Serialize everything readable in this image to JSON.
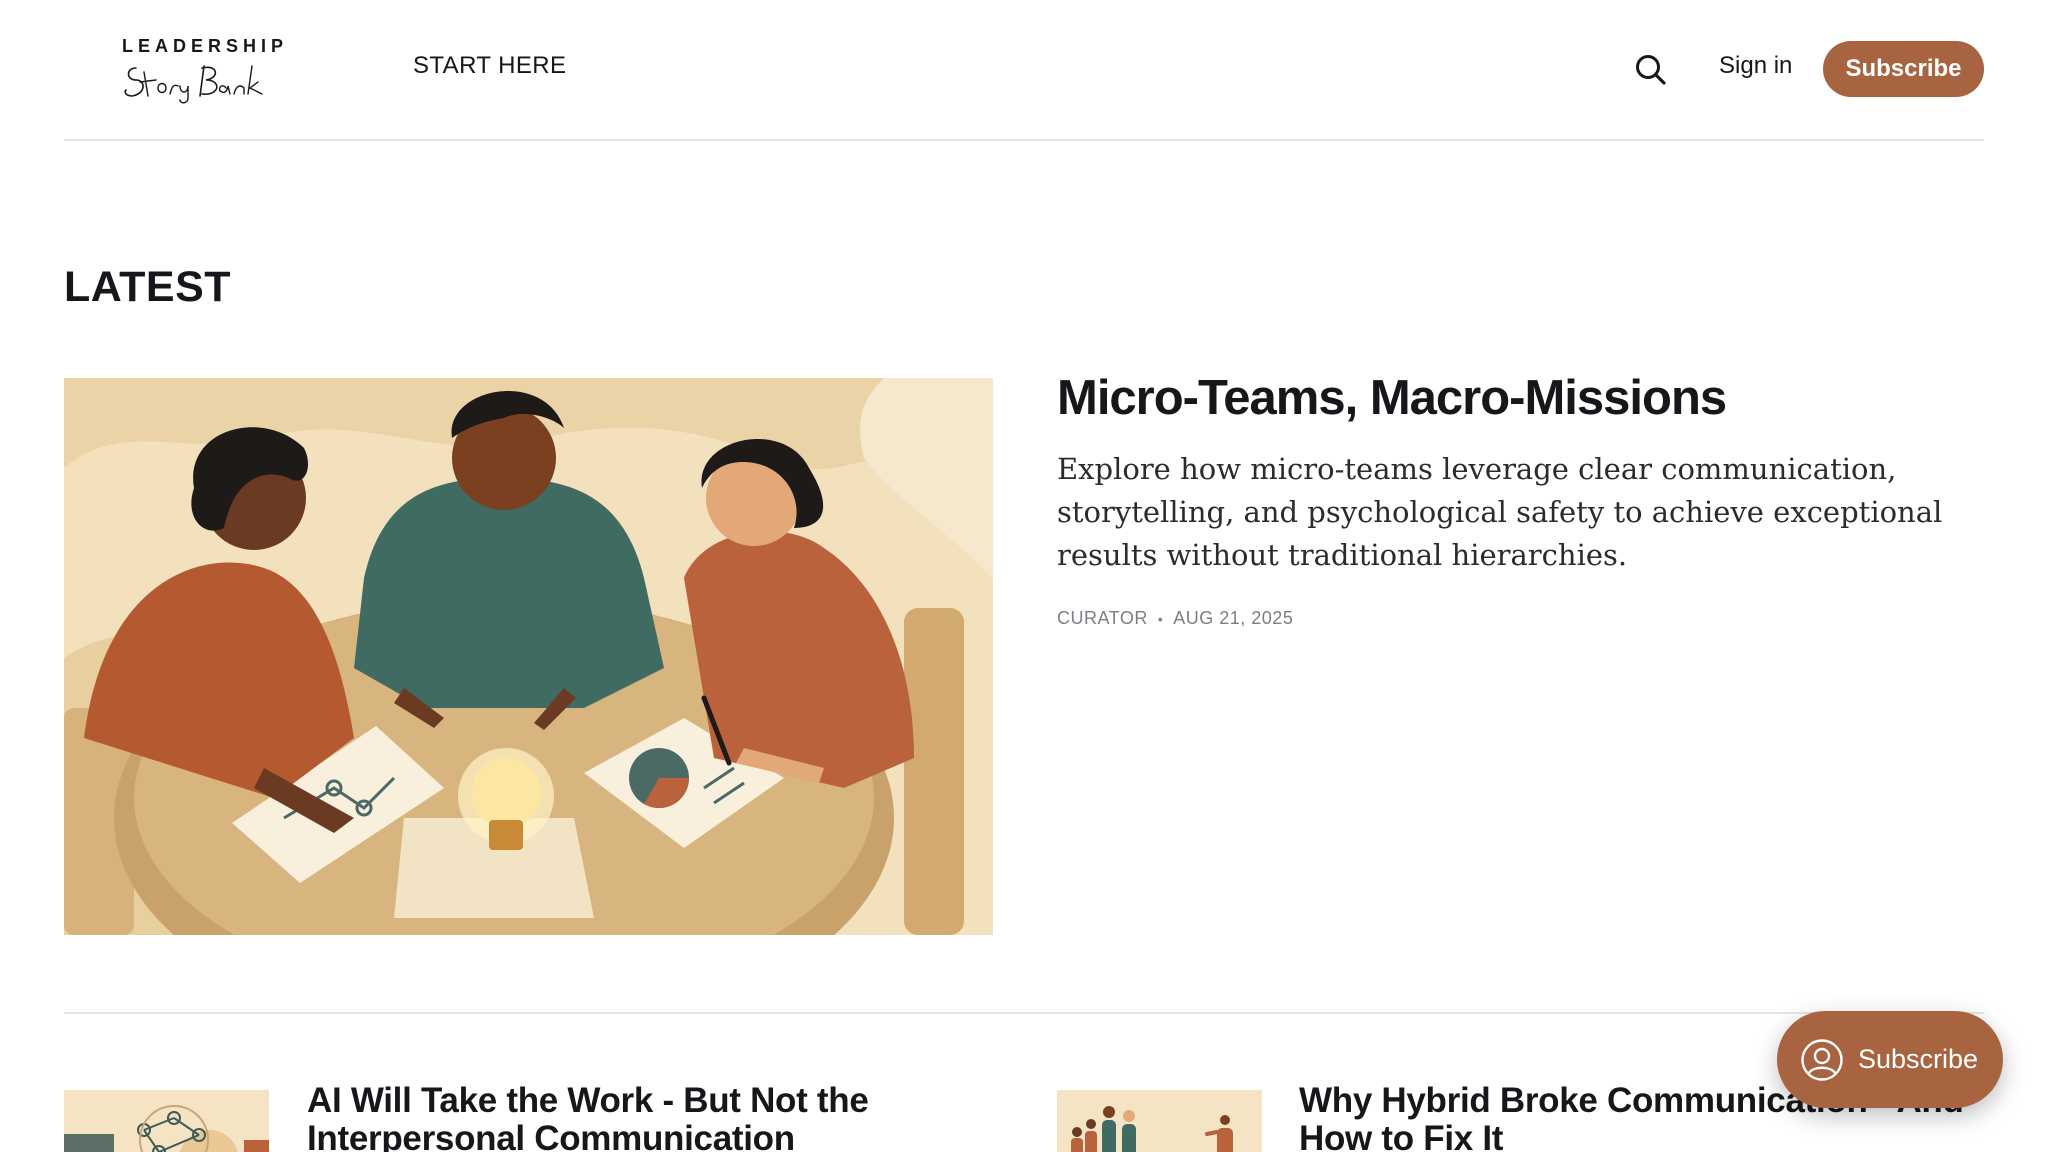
{
  "header": {
    "logo_top": "LEADERSHIP",
    "logo_script": "Story Bank",
    "nav": [
      {
        "label": "START HERE"
      }
    ],
    "search_icon": "search-icon",
    "signin_label": "Sign in",
    "subscribe_label": "Subscribe"
  },
  "section": {
    "title": "LATEST"
  },
  "featured": {
    "title": "Micro-Teams, Macro-Missions",
    "excerpt": "Explore how micro-teams leverage clear communication, storytelling, and psychological safety to achieve exceptional results without traditional hierarchies.",
    "author": "CURATOR",
    "separator": "•",
    "date": "AUG 21, 2025",
    "image_icon": "team-illustration"
  },
  "posts": [
    {
      "title": "AI Will Take the Work - But Not the Interpersonal Communication",
      "image_icon": "ai-network-illustration"
    },
    {
      "title": "Why Hybrid Broke Communication - And How to Fix It",
      "image_icon": "hybrid-team-illustration"
    }
  ],
  "portal": {
    "label": "Subscribe",
    "icon": "user-circle-icon"
  },
  "colors": {
    "accent": "#a86440",
    "text": "#15171a",
    "muted": "#7b7f85",
    "divider": "#e6e6e6"
  }
}
